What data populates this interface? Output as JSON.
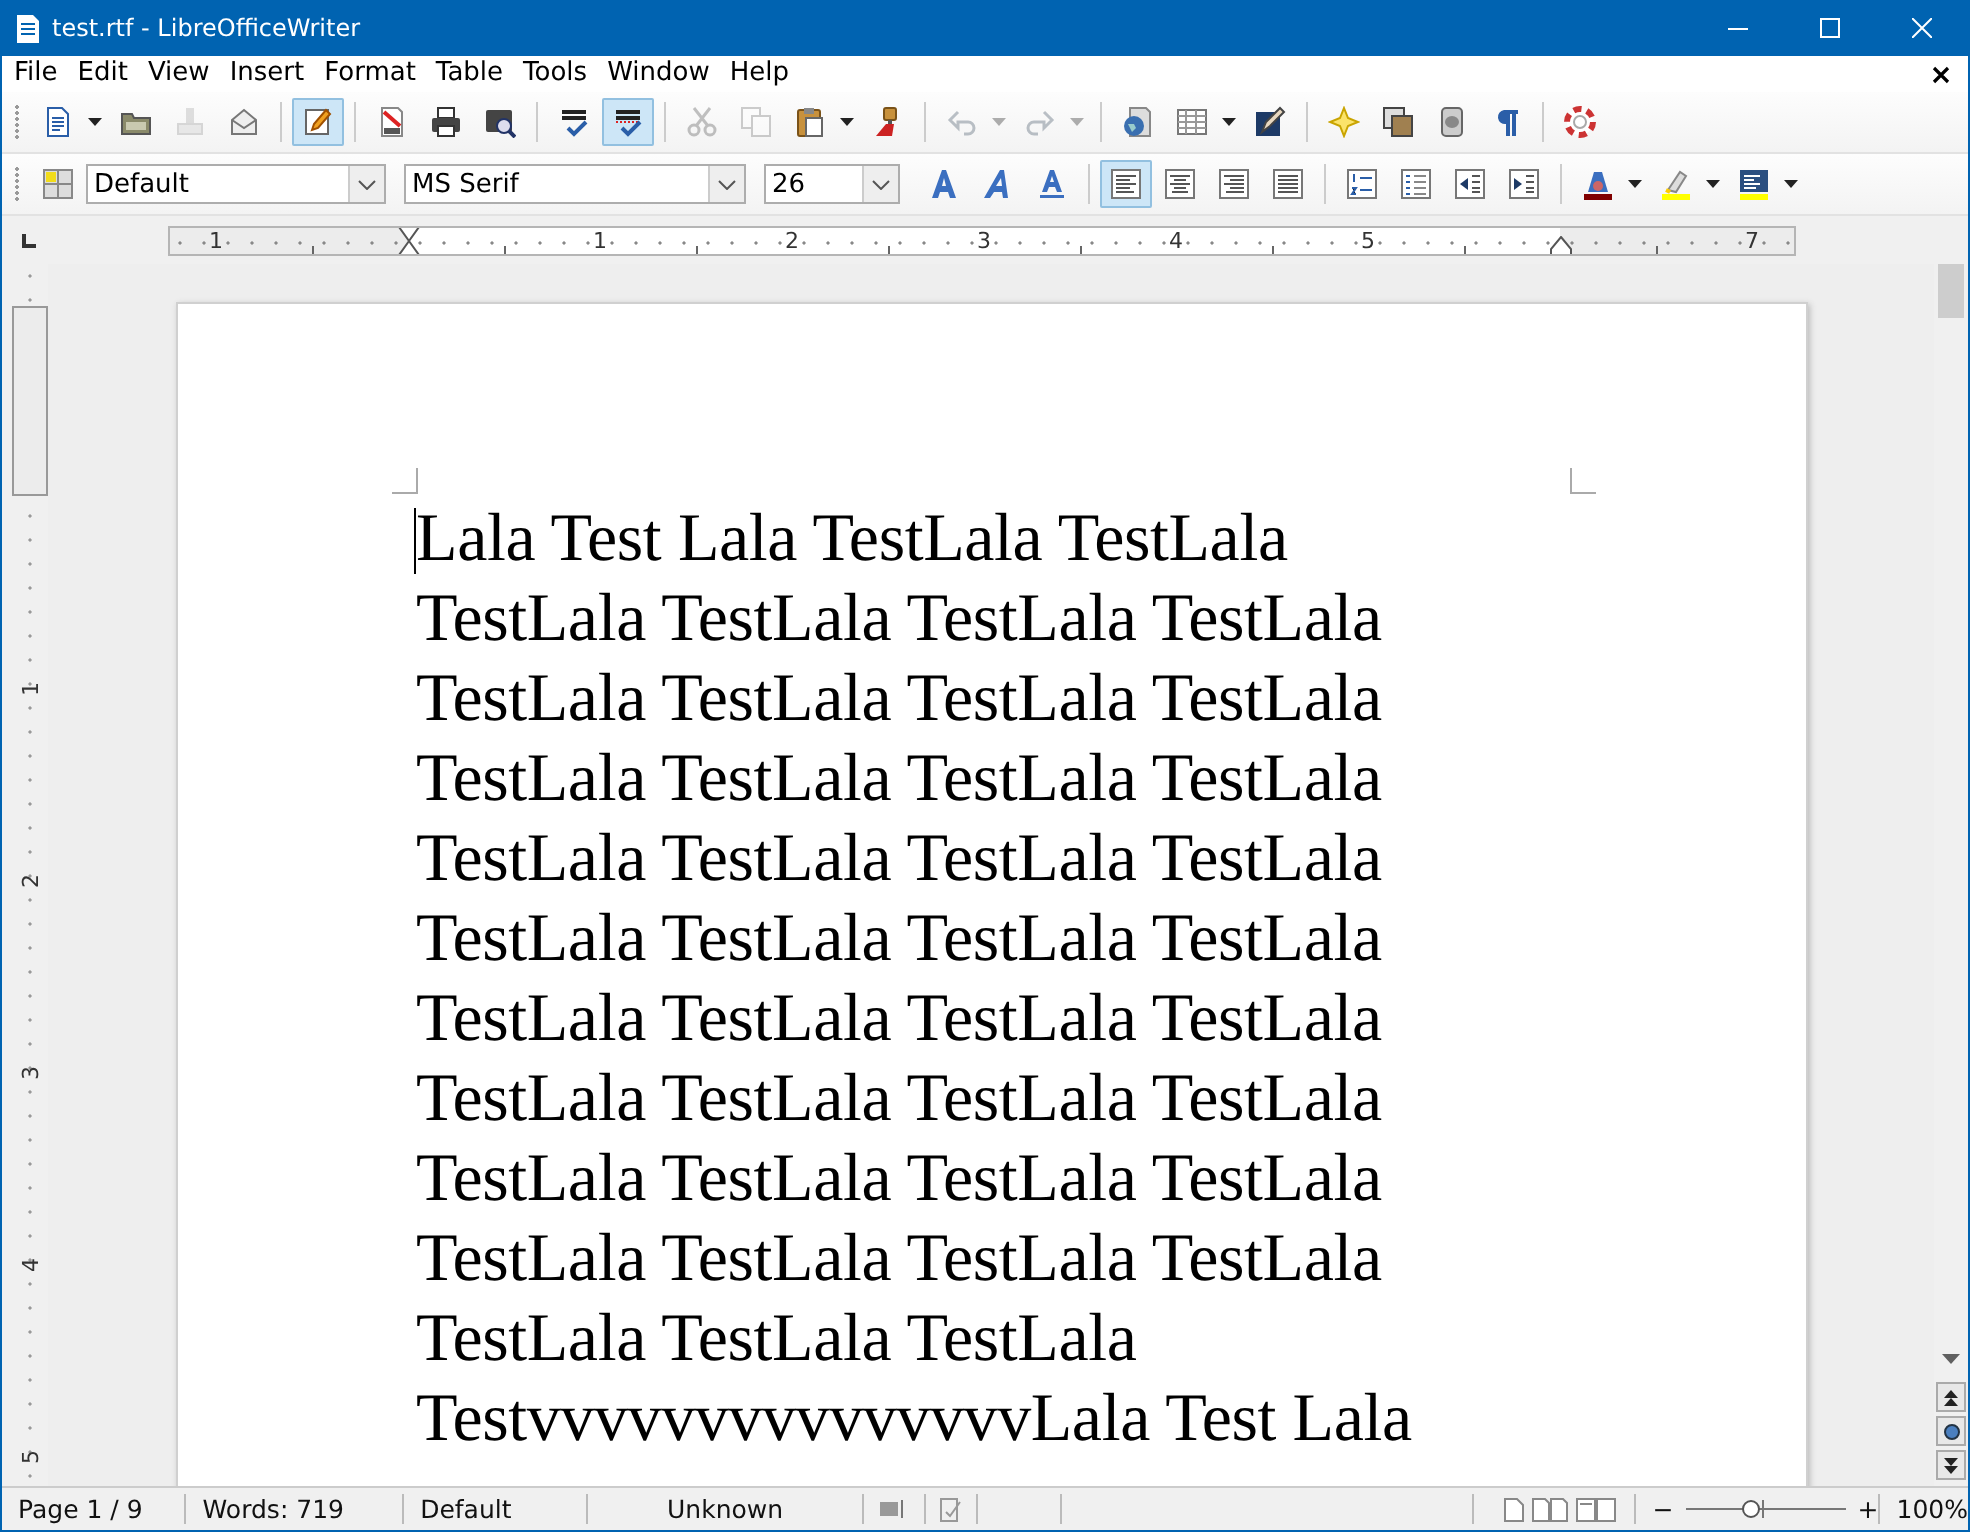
{
  "window": {
    "title": "test.rtf - LibreOfficeWriter"
  },
  "menu_bar": {
    "items": [
      "File",
      "Edit",
      "View",
      "Insert",
      "Format",
      "Table",
      "Tools",
      "Window",
      "Help"
    ]
  },
  "standard_toolbar": {
    "groups": [
      [
        {
          "kind": "new",
          "selected": false,
          "disabled": false
        },
        {
          "kind": "menu-arrow",
          "disabled": false
        },
        {
          "kind": "open",
          "selected": false,
          "disabled": false
        },
        {
          "kind": "print-direct",
          "selected": false,
          "disabled": true
        },
        {
          "kind": "email",
          "selected": false,
          "disabled": false
        }
      ],
      [
        {
          "kind": "edit",
          "selected": true,
          "disabled": false
        }
      ],
      [
        {
          "kind": "pdf",
          "selected": false,
          "disabled": false
        },
        {
          "kind": "print",
          "selected": false,
          "disabled": false
        },
        {
          "kind": "preview",
          "selected": false,
          "disabled": false
        }
      ],
      [
        {
          "kind": "spell",
          "selected": false,
          "disabled": false
        },
        {
          "kind": "autospell",
          "selected": true,
          "disabled": false
        }
      ],
      [
        {
          "kind": "cut",
          "selected": false,
          "disabled": true
        },
        {
          "kind": "copy",
          "selected": false,
          "disabled": true
        },
        {
          "kind": "paste",
          "selected": false,
          "disabled": false
        },
        {
          "kind": "menu-arrow",
          "disabled": false
        },
        {
          "kind": "clone",
          "selected": false,
          "disabled": false
        }
      ],
      [
        {
          "kind": "undo",
          "selected": false,
          "disabled": true
        },
        {
          "kind": "menu-arrow",
          "disabled": true
        },
        {
          "kind": "redo",
          "selected": false,
          "disabled": true
        },
        {
          "kind": "menu-arrow",
          "disabled": true
        }
      ],
      [
        {
          "kind": "navigator",
          "selected": false,
          "disabled": false
        },
        {
          "kind": "table",
          "selected": false,
          "disabled": false
        },
        {
          "kind": "menu-arrow",
          "disabled": false
        },
        {
          "kind": "draw",
          "selected": false,
          "disabled": false
        }
      ],
      [
        {
          "kind": "star",
          "selected": false,
          "disabled": false
        },
        {
          "kind": "gallery",
          "selected": false,
          "disabled": false
        },
        {
          "kind": "datasource",
          "selected": false,
          "disabled": false
        },
        {
          "kind": "pilcrow",
          "selected": false,
          "disabled": false
        }
      ],
      [
        {
          "kind": "help",
          "selected": false,
          "disabled": false
        }
      ]
    ]
  },
  "formatting_toolbar": {
    "groups": [
      [
        {
          "kind": "styles",
          "selected": false,
          "disabled": false
        },
        {
          "kind": "style-combo",
          "value": "Default"
        },
        {
          "kind": "font-combo",
          "value": "MS Serif"
        },
        {
          "kind": "size-combo",
          "value": "26"
        },
        {
          "kind": "bold",
          "selected": false,
          "disabled": false
        },
        {
          "kind": "italic",
          "selected": false,
          "disabled": false
        },
        {
          "kind": "underline",
          "selected": false,
          "disabled": false
        }
      ],
      [
        {
          "kind": "align-left",
          "selected": true,
          "disabled": false
        },
        {
          "kind": "align-center",
          "selected": false,
          "disabled": false
        },
        {
          "kind": "align-right",
          "selected": false,
          "disabled": false
        },
        {
          "kind": "justify",
          "selected": false,
          "disabled": false
        }
      ],
      [
        {
          "kind": "numbering",
          "selected": false,
          "disabled": false
        },
        {
          "kind": "bullets",
          "selected": false,
          "disabled": false
        },
        {
          "kind": "outdent",
          "selected": false,
          "disabled": false
        },
        {
          "kind": "indent",
          "selected": false,
          "disabled": false
        }
      ],
      [
        {
          "kind": "font-color",
          "selected": false,
          "disabled": false
        },
        {
          "kind": "menu-arrow",
          "disabled": false
        },
        {
          "kind": "highlight",
          "selected": false,
          "disabled": false
        },
        {
          "kind": "menu-arrow",
          "disabled": false
        },
        {
          "kind": "background",
          "selected": false,
          "disabled": false
        },
        {
          "kind": "menu-arrow",
          "disabled": false
        }
      ]
    ]
  },
  "ruler": {
    "marks": [
      {
        "kind": "number",
        "label": "1"
      },
      {
        "kind": "indent"
      },
      {
        "kind": "number",
        "label": "1"
      },
      {
        "kind": "number",
        "label": "2"
      },
      {
        "kind": "number",
        "label": "3"
      },
      {
        "kind": "number",
        "label": "4"
      },
      {
        "kind": "number",
        "label": "5"
      },
      {
        "kind": "tab"
      },
      {
        "kind": "number",
        "label": "7"
      }
    ]
  },
  "vertical_ruler": {
    "labels": [
      "1",
      "2",
      "3",
      "4",
      "5"
    ]
  },
  "document": {
    "lines": [
      "Lala Test Lala TestLala TestLala",
      "TestLala TestLala TestLala TestLala",
      "TestLala TestLala TestLala TestLala",
      "TestLala TestLala TestLala TestLala",
      "TestLala TestLala TestLala TestLala",
      "TestLala TestLala TestLala TestLala",
      "TestLala TestLala TestLala TestLala",
      "TestLala TestLala TestLala TestLala",
      "TestLala TestLala TestLala TestLala",
      "TestLala TestLala TestLala TestLala",
      "TestLala TestLala TestLala",
      "TestvvvvvvvvvvvvvvvLala Test Lala"
    ]
  },
  "status_bar": {
    "page": "Page 1 / 9",
    "words": "Words: 719",
    "style": "Default",
    "language": "Unknown",
    "zoom": {
      "minus": "−",
      "plus": "+",
      "level": 0.4
    },
    "zoom_percent": "100%"
  }
}
